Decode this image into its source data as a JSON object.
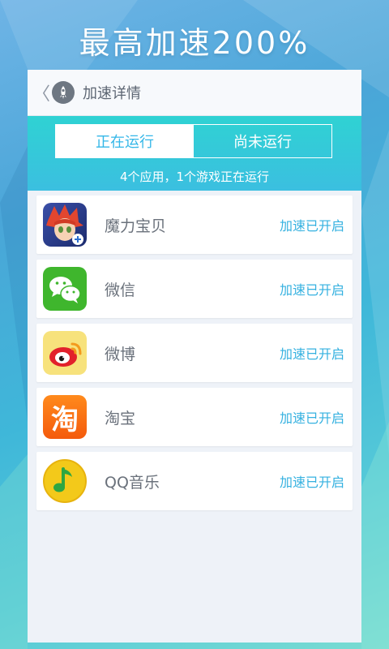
{
  "headline": "最高加速200%",
  "topbar": {
    "back_glyph": "〈",
    "title": "加速详情"
  },
  "tabs": {
    "running": "正在运行",
    "not_running": "尚未运行"
  },
  "summary": "4个应用，1个游戏正在运行",
  "apps": [
    {
      "name": "魔力宝贝",
      "status": "加速已开启",
      "icon": "game-character-icon"
    },
    {
      "name": "微信",
      "status": "加速已开启",
      "icon": "wechat-icon"
    },
    {
      "name": "微博",
      "status": "加速已开启",
      "icon": "weibo-icon"
    },
    {
      "name": "淘宝",
      "status": "加速已开启",
      "icon": "taobao-icon",
      "icon_text": "淘"
    },
    {
      "name": "QQ音乐",
      "status": "加速已开启",
      "icon": "qq-music-icon"
    }
  ],
  "colors": {
    "accent": "#35b7e8",
    "band_top": "#2fd2d3",
    "band_bottom": "#3bbfe0"
  }
}
